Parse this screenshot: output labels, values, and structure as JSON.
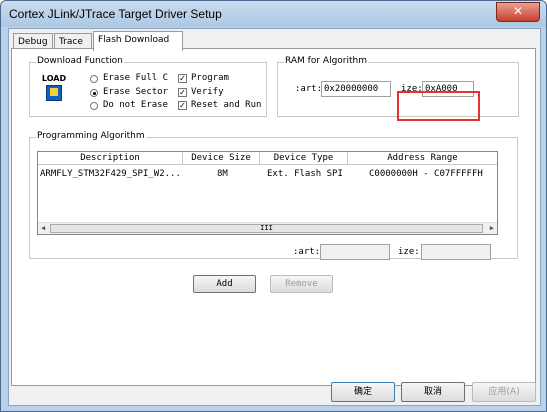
{
  "window": {
    "title": "Cortex JLink/JTrace Target Driver Setup",
    "close_glyph": "✕"
  },
  "tabs": [
    {
      "label": "Debug"
    },
    {
      "label": "Trace"
    },
    {
      "label": "Flash Download"
    }
  ],
  "download_function": {
    "group_label": "Download Function",
    "icon_text": "LOAD",
    "erase_options": [
      {
        "label": "Erase Full C",
        "selected": false
      },
      {
        "label": "Erase Sector",
        "selected": true
      },
      {
        "label": "Do not Erase",
        "selected": false
      }
    ],
    "checks": [
      {
        "label": "Program",
        "checked": true
      },
      {
        "label": "Verify",
        "checked": true
      },
      {
        "label": "Reset and Run",
        "checked": true
      }
    ]
  },
  "ram": {
    "group_label": "RAM for Algorithm",
    "start_label": ":art:",
    "start_value": "0x20000000",
    "size_label": "ize:",
    "size_value": "0xA000"
  },
  "programming_algorithm": {
    "group_label": "Programming Algorithm",
    "columns": [
      "Description",
      "Device Size",
      "Device Type",
      "Address Range"
    ],
    "rows": [
      {
        "description": "ARMFLY_STM32F429_SPI_W2...",
        "size": "8M",
        "type": "Ext. Flash SPI",
        "range": "C0000000H - C07FFFFFH"
      }
    ],
    "scroll_grip": "III",
    "start_label": ":art:",
    "start_value": "",
    "size_label": "ize:",
    "size_value": ""
  },
  "buttons": {
    "add": "Add",
    "remove": "Remove"
  },
  "footer": {
    "ok": "确定",
    "cancel": "取消",
    "apply": "应用(A)"
  },
  "colors": {
    "highlight": "#e53232",
    "title_bar": "#b9d1ea"
  }
}
